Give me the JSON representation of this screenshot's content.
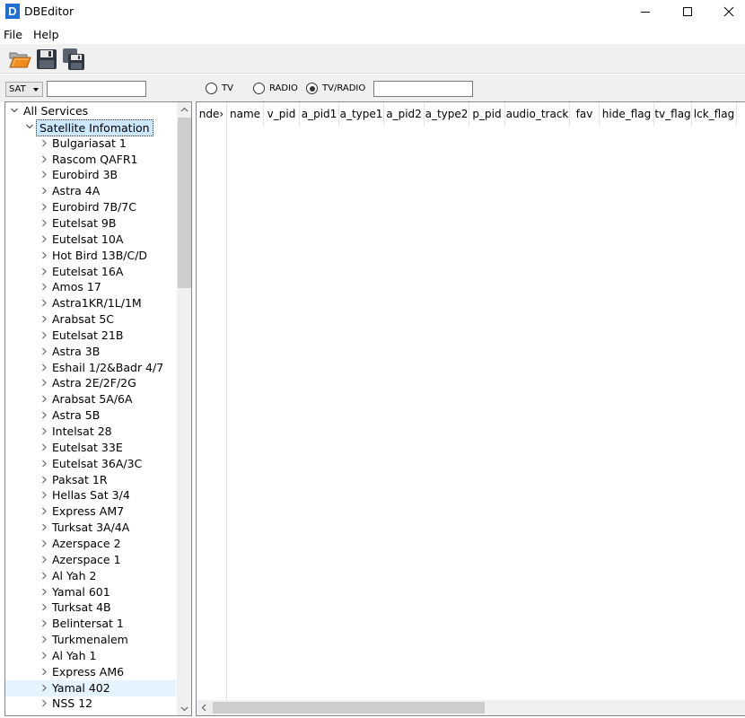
{
  "window": {
    "title": "DBEditor",
    "icon_letter": "D"
  },
  "menu": {
    "file": "File",
    "help": "Help"
  },
  "toolbar": {
    "open_icon": "folder-open-icon",
    "save_icon": "save-icon",
    "save_all_icon": "save-all-icon"
  },
  "filter": {
    "sat_select": "SAT",
    "sat_input": "",
    "radios": {
      "tv": "TV",
      "radio": "RADIO",
      "tvradio": "TV/RADIO"
    },
    "selected_radio": "tvradio",
    "search_input": ""
  },
  "tree": {
    "root": "All Services",
    "group": "Satellite Infomation",
    "items": [
      "Bulgariasat 1",
      "Rascom QAFR1",
      "Eurobird 3B",
      "Astra 4A",
      "Eurobird 7B/7C",
      "Eutelsat 9B",
      "Eutelsat 10A",
      "Hot Bird 13B/C/D",
      "Eutelsat 16A",
      "Amos 17",
      "Astra1KR/1L/1M",
      "Arabsat 5C",
      "Eutelsat 21B",
      "Astra 3B",
      "Eshail 1/2&Badr 4/7",
      "Astra 2E/2F/2G",
      "Arabsat 5A/6A",
      "Astra 5B",
      "Intelsat 28",
      "Eutelsat 33E",
      "Eutelsat 36A/3C",
      "Paksat 1R",
      "Hellas Sat 3/4",
      "Express AM7",
      "Turksat 3A/4A",
      "Azerspace 2",
      "Azerspace 1",
      "Al Yah 2",
      "Yamal 601",
      "Turksat 4B",
      "Belintersat 1",
      "Turkmenalem",
      "Al Yah 1",
      "Express AM6",
      "Yamal 402",
      "NSS 12"
    ]
  },
  "grid": {
    "columns": [
      "nde›",
      "name",
      "v_pid",
      "a_pid1",
      "a_type1",
      "a_pid2",
      "a_type2",
      "p_pid",
      "audio_track",
      "fav",
      "hide_flag",
      "tv_flag",
      "lck_flag"
    ]
  },
  "colors": {
    "accent": "#1e6fd1",
    "selection": "#cce8ff",
    "toolbar_bg": "#f0f0f0"
  }
}
